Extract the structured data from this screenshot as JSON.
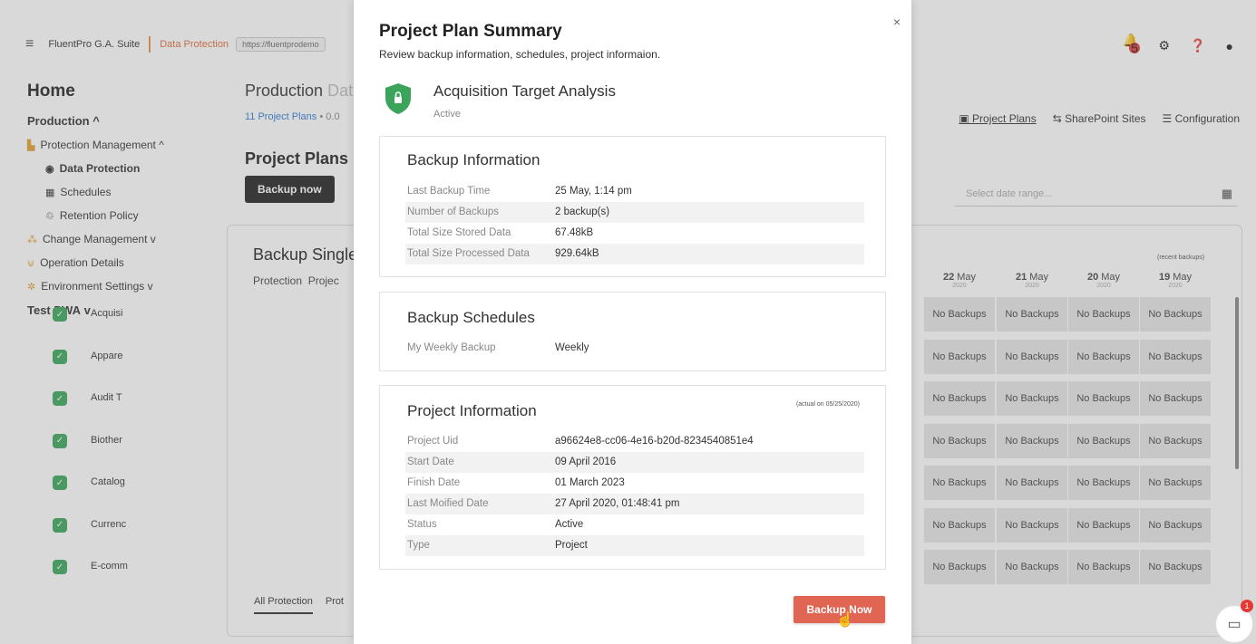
{
  "app": {
    "brand": "FluentPro G.A. Suite",
    "module": "Data Protection",
    "url": "https://fluentprodemo",
    "notification_count": "5"
  },
  "sidebar": {
    "home": "Home",
    "items": [
      {
        "label": "Production",
        "chevron": "^"
      },
      {
        "label": "Protection Management",
        "chevron": "^"
      },
      {
        "label": "Data Protection"
      },
      {
        "label": "Schedules"
      },
      {
        "label": "Retention Policy"
      },
      {
        "label": "Change Management",
        "chevron": "v"
      },
      {
        "label": "Operation Details"
      },
      {
        "label": "Environment Settings",
        "chevron": "v"
      },
      {
        "label": "Test PWA",
        "chevron": "v"
      }
    ]
  },
  "main": {
    "title": "Production",
    "title_light": "Dat",
    "subtitle": "11 Project Plans",
    "subtitle_extra": "• 0.0",
    "section_title": "Project Plans",
    "backup_button": "Backup now",
    "card_title": "Backup Single",
    "col_protection": "Protection",
    "col_project": "Projec",
    "rows": [
      "Acquisi",
      "Appare",
      "Audit T",
      "Biother",
      "Catalog",
      "Currenc",
      "E-comm"
    ],
    "no_backups": "No Backups",
    "bottom_tabs": [
      "All Protection",
      "Prot"
    ],
    "recent_label": "(recent backups)"
  },
  "right_tabs": [
    "Project Plans",
    "SharePoint Sites",
    "Configuration"
  ],
  "date_range_placeholder": "Select date range...",
  "dates": [
    {
      "day": "22",
      "month": "May",
      "year": "2020"
    },
    {
      "day": "21",
      "month": "May",
      "year": "2020"
    },
    {
      "day": "20",
      "month": "May",
      "year": "2020"
    },
    {
      "day": "19",
      "month": "May",
      "year": "2020"
    }
  ],
  "chat_badge": "1",
  "modal": {
    "title": "Project Plan Summary",
    "subtitle": "Review backup information, schedules, project informaion.",
    "close": "×",
    "project_name": "Acquisition Target Analysis",
    "project_status": "Active",
    "backup_info": {
      "title": "Backup Information",
      "rows": [
        {
          "k": "Last Backup Time",
          "v": "25 May, 1:14 pm"
        },
        {
          "k": "Number of Backups",
          "v": "2 backup(s)"
        },
        {
          "k": "Total Size Stored Data",
          "v": "67.48kB"
        },
        {
          "k": "Total Size Processed Data",
          "v": "929.64kB"
        }
      ]
    },
    "backup_schedules": {
      "title": "Backup Schedules",
      "rows": [
        {
          "k": "My Weekly Backup",
          "v": "Weekly"
        }
      ]
    },
    "project_info": {
      "title": "Project Information",
      "actual": "(actual on 05/25/2020)",
      "rows": [
        {
          "k": "Project Uid",
          "v": "a96624e8-cc06-4e16-b20d-8234540851e4"
        },
        {
          "k": "Start Date",
          "v": "09 April 2016"
        },
        {
          "k": "Finish Date",
          "v": "01 March 2023"
        },
        {
          "k": "Last Moified Date",
          "v": "27 April 2020, 01:48:41 pm"
        },
        {
          "k": "Status",
          "v": "Active"
        },
        {
          "k": "Type",
          "v": "Project"
        }
      ]
    },
    "backup_now": "Backup Now"
  },
  "colors": {
    "accent": "#e06552",
    "shield": "#3aa55a",
    "link": "#2e7bd6"
  }
}
